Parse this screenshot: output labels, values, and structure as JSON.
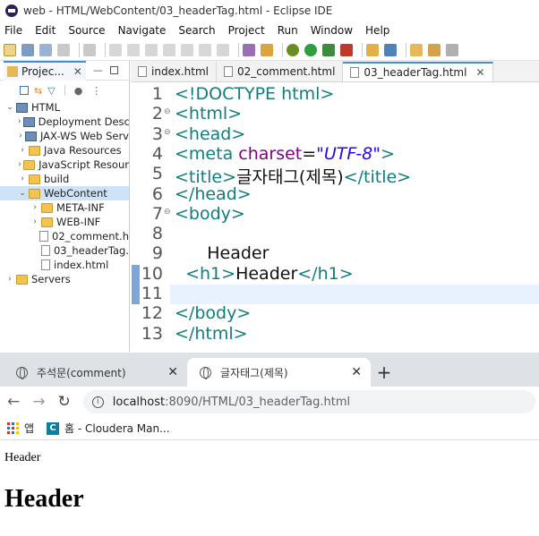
{
  "window": {
    "title": "web - HTML/WebContent/03_headerTag.html - Eclipse IDE"
  },
  "menu": [
    "File",
    "Edit",
    "Source",
    "Navigate",
    "Search",
    "Project",
    "Run",
    "Window",
    "Help"
  ],
  "explorer": {
    "tab_label": "Projec...",
    "tree": [
      {
        "label": "HTML",
        "depth": 0,
        "expanded": true,
        "icon": "project-icon"
      },
      {
        "label": "Deployment Desc",
        "depth": 1,
        "expanded": false,
        "icon": "deployment-icon"
      },
      {
        "label": "JAX-WS Web Serv",
        "depth": 1,
        "expanded": false,
        "icon": "webservice-icon"
      },
      {
        "label": "Java Resources",
        "depth": 1,
        "expanded": false,
        "icon": "java-icon"
      },
      {
        "label": "JavaScript Resour",
        "depth": 1,
        "expanded": false,
        "icon": "javascript-icon"
      },
      {
        "label": "build",
        "depth": 1,
        "expanded": false,
        "icon": "folder-icon"
      },
      {
        "label": "WebContent",
        "depth": 1,
        "expanded": true,
        "icon": "folder-icon",
        "selected": true
      },
      {
        "label": "META-INF",
        "depth": 2,
        "expanded": false,
        "icon": "folder-icon"
      },
      {
        "label": "WEB-INF",
        "depth": 2,
        "expanded": false,
        "icon": "folder-icon"
      },
      {
        "label": "02_comment.h",
        "depth": 2,
        "icon": "file-icon"
      },
      {
        "label": "03_headerTag.",
        "depth": 2,
        "icon": "file-icon"
      },
      {
        "label": "index.html",
        "depth": 2,
        "icon": "file-icon"
      },
      {
        "label": "Servers",
        "depth": 0,
        "expanded": false,
        "icon": "folder-icon"
      }
    ]
  },
  "editor": {
    "tabs": [
      {
        "label": "index.html",
        "active": false
      },
      {
        "label": "02_comment.html",
        "active": false
      },
      {
        "label": "03_headerTag.html",
        "active": true
      }
    ],
    "lines": [
      {
        "n": "1",
        "fold": "",
        "parts": [
          {
            "c": "tag",
            "t": "<!DOCTYPE html>"
          }
        ]
      },
      {
        "n": "2",
        "fold": "⊖",
        "parts": [
          {
            "c": "tag",
            "t": "<html>"
          }
        ]
      },
      {
        "n": "3",
        "fold": "⊖",
        "parts": [
          {
            "c": "tag",
            "t": "<head>"
          }
        ]
      },
      {
        "n": "4",
        "fold": "",
        "parts": [
          {
            "c": "tag",
            "t": "<meta "
          },
          {
            "c": "attr",
            "t": "charset"
          },
          {
            "c": "",
            "t": "="
          },
          {
            "c": "str",
            "t": "\"UTF-8\""
          },
          {
            "c": "tag",
            "t": ">"
          }
        ]
      },
      {
        "n": "5",
        "fold": "",
        "parts": [
          {
            "c": "tag",
            "t": "<title>"
          },
          {
            "c": "",
            "t": "글자태그(제목)"
          },
          {
            "c": "tag",
            "t": "</title>"
          }
        ]
      },
      {
        "n": "6",
        "fold": "",
        "parts": [
          {
            "c": "tag",
            "t": "</head>"
          }
        ]
      },
      {
        "n": "7",
        "fold": "⊖",
        "parts": [
          {
            "c": "tag",
            "t": "<body>"
          }
        ]
      },
      {
        "n": "8",
        "fold": "",
        "parts": []
      },
      {
        "n": "9",
        "fold": "",
        "parts": [
          {
            "c": "",
            "t": "      Header"
          }
        ]
      },
      {
        "n": "10",
        "fold": "",
        "parts": [
          {
            "c": "",
            "t": "  "
          },
          {
            "c": "tag",
            "t": "<h1>"
          },
          {
            "c": "",
            "t": "Header"
          },
          {
            "c": "tag",
            "t": "</h1>"
          }
        ]
      },
      {
        "n": "11",
        "fold": "",
        "parts": []
      },
      {
        "n": "12",
        "fold": "",
        "parts": [
          {
            "c": "tag",
            "t": "</body>"
          }
        ]
      },
      {
        "n": "13",
        "fold": "",
        "parts": [
          {
            "c": "tag",
            "t": "</html>"
          }
        ]
      }
    ]
  },
  "browser": {
    "tabs": [
      {
        "label": "주석문(comment)",
        "active": false
      },
      {
        "label": "글자태그(제목)",
        "active": true
      }
    ],
    "url_host": "localhost",
    "url_rest": ":8090/HTML/03_headerTag.html",
    "bookmarks": [
      {
        "label": "앱"
      },
      {
        "label": "홈 - Cloudera Man..."
      }
    ],
    "page": {
      "text": "Header",
      "h1": "Header"
    }
  }
}
